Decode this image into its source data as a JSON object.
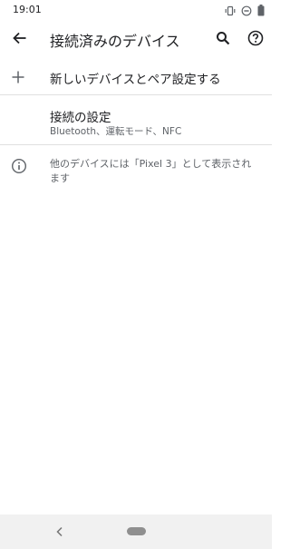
{
  "status_bar": {
    "time": "19:01",
    "icons": [
      "vibrate-icon",
      "do-not-disturb-icon",
      "battery-icon"
    ]
  },
  "app_bar": {
    "title": "接続済みのデバイス",
    "back_icon": "arrow-back-icon",
    "search_icon": "search-icon",
    "help_icon": "help-icon"
  },
  "list": {
    "add_device": {
      "icon": "plus-icon",
      "label": "新しいデバイスとペア設定する"
    },
    "connection_settings": {
      "title": "接続の設定",
      "summary": "Bluetooth、運転モード、NFC"
    },
    "info": {
      "icon": "info-icon",
      "text": "他のデバイスには「Pixel 3」として表示されます"
    }
  },
  "nav_bar": {
    "back_icon": "nav-back-icon",
    "home_icon": "home-pill-icon"
  },
  "colors": {
    "text_primary": "#202124",
    "text_secondary": "#5f6368",
    "divider": "#e0e0e0",
    "nav_bar_bg": "#f1f1f1"
  }
}
